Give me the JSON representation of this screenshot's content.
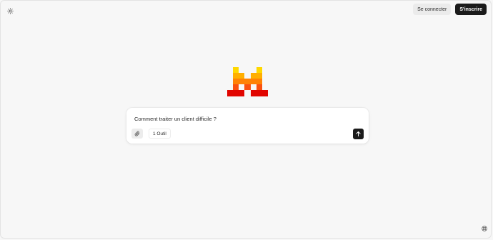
{
  "header": {
    "theme_icon": "sun-icon",
    "login_label": "Se connecter",
    "signup_label": "S'inscrire"
  },
  "logo": {
    "name": "mistral-logo",
    "colors": {
      "yellow": "#ffd800",
      "light_orange": "#ffaf00",
      "orange": "#ff8205",
      "dark_orange": "#fa500f",
      "red": "#e10500"
    }
  },
  "composer": {
    "prompt_text": "Comment traiter un client difficile ?",
    "attach_icon": "paperclip-icon",
    "tools_label": "1 Outil",
    "send_icon": "arrow-up-icon"
  },
  "footer": {
    "help_icon": "help-circle-icon"
  },
  "colors": {
    "background": "#f7f7f7",
    "card": "#ffffff",
    "primary_dark": "#1b1b1b",
    "secondary_button": "#ebebeb"
  }
}
